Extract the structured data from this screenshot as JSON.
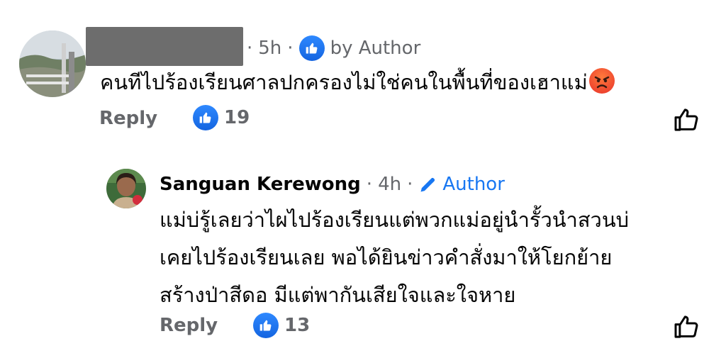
{
  "comment": {
    "author_name_redacted": "",
    "time": "5h",
    "by_author_label": "by Author",
    "text": "คนทีไปร้องเรียนศาลปกครองไม่ใช่คนในพื้นที่ของเฮาแม่",
    "emoji": "angry-face",
    "reply_label": "Reply",
    "like_count": "19"
  },
  "reply": {
    "author_name": "Sanguan Kerewong",
    "time": "4h",
    "author_badge": "Author",
    "text_lines": [
      "แม่บ่รู้เลยว่าไผไปร้องเรียนแต่พวกแม่อยู่นำรั้วนำสวนบ่",
      "เคยไปร้องเรียนเลย พอได้ยินข่าวคำสั่งมาให้โยกย้าย",
      "สร้างป่าสีดอ มีแต่พากันเสียใจและใจหาย"
    ],
    "reply_label": "Reply",
    "like_count": "13"
  },
  "colors": {
    "accent": "#1877f2",
    "muted": "#65676b",
    "text": "#050505"
  }
}
